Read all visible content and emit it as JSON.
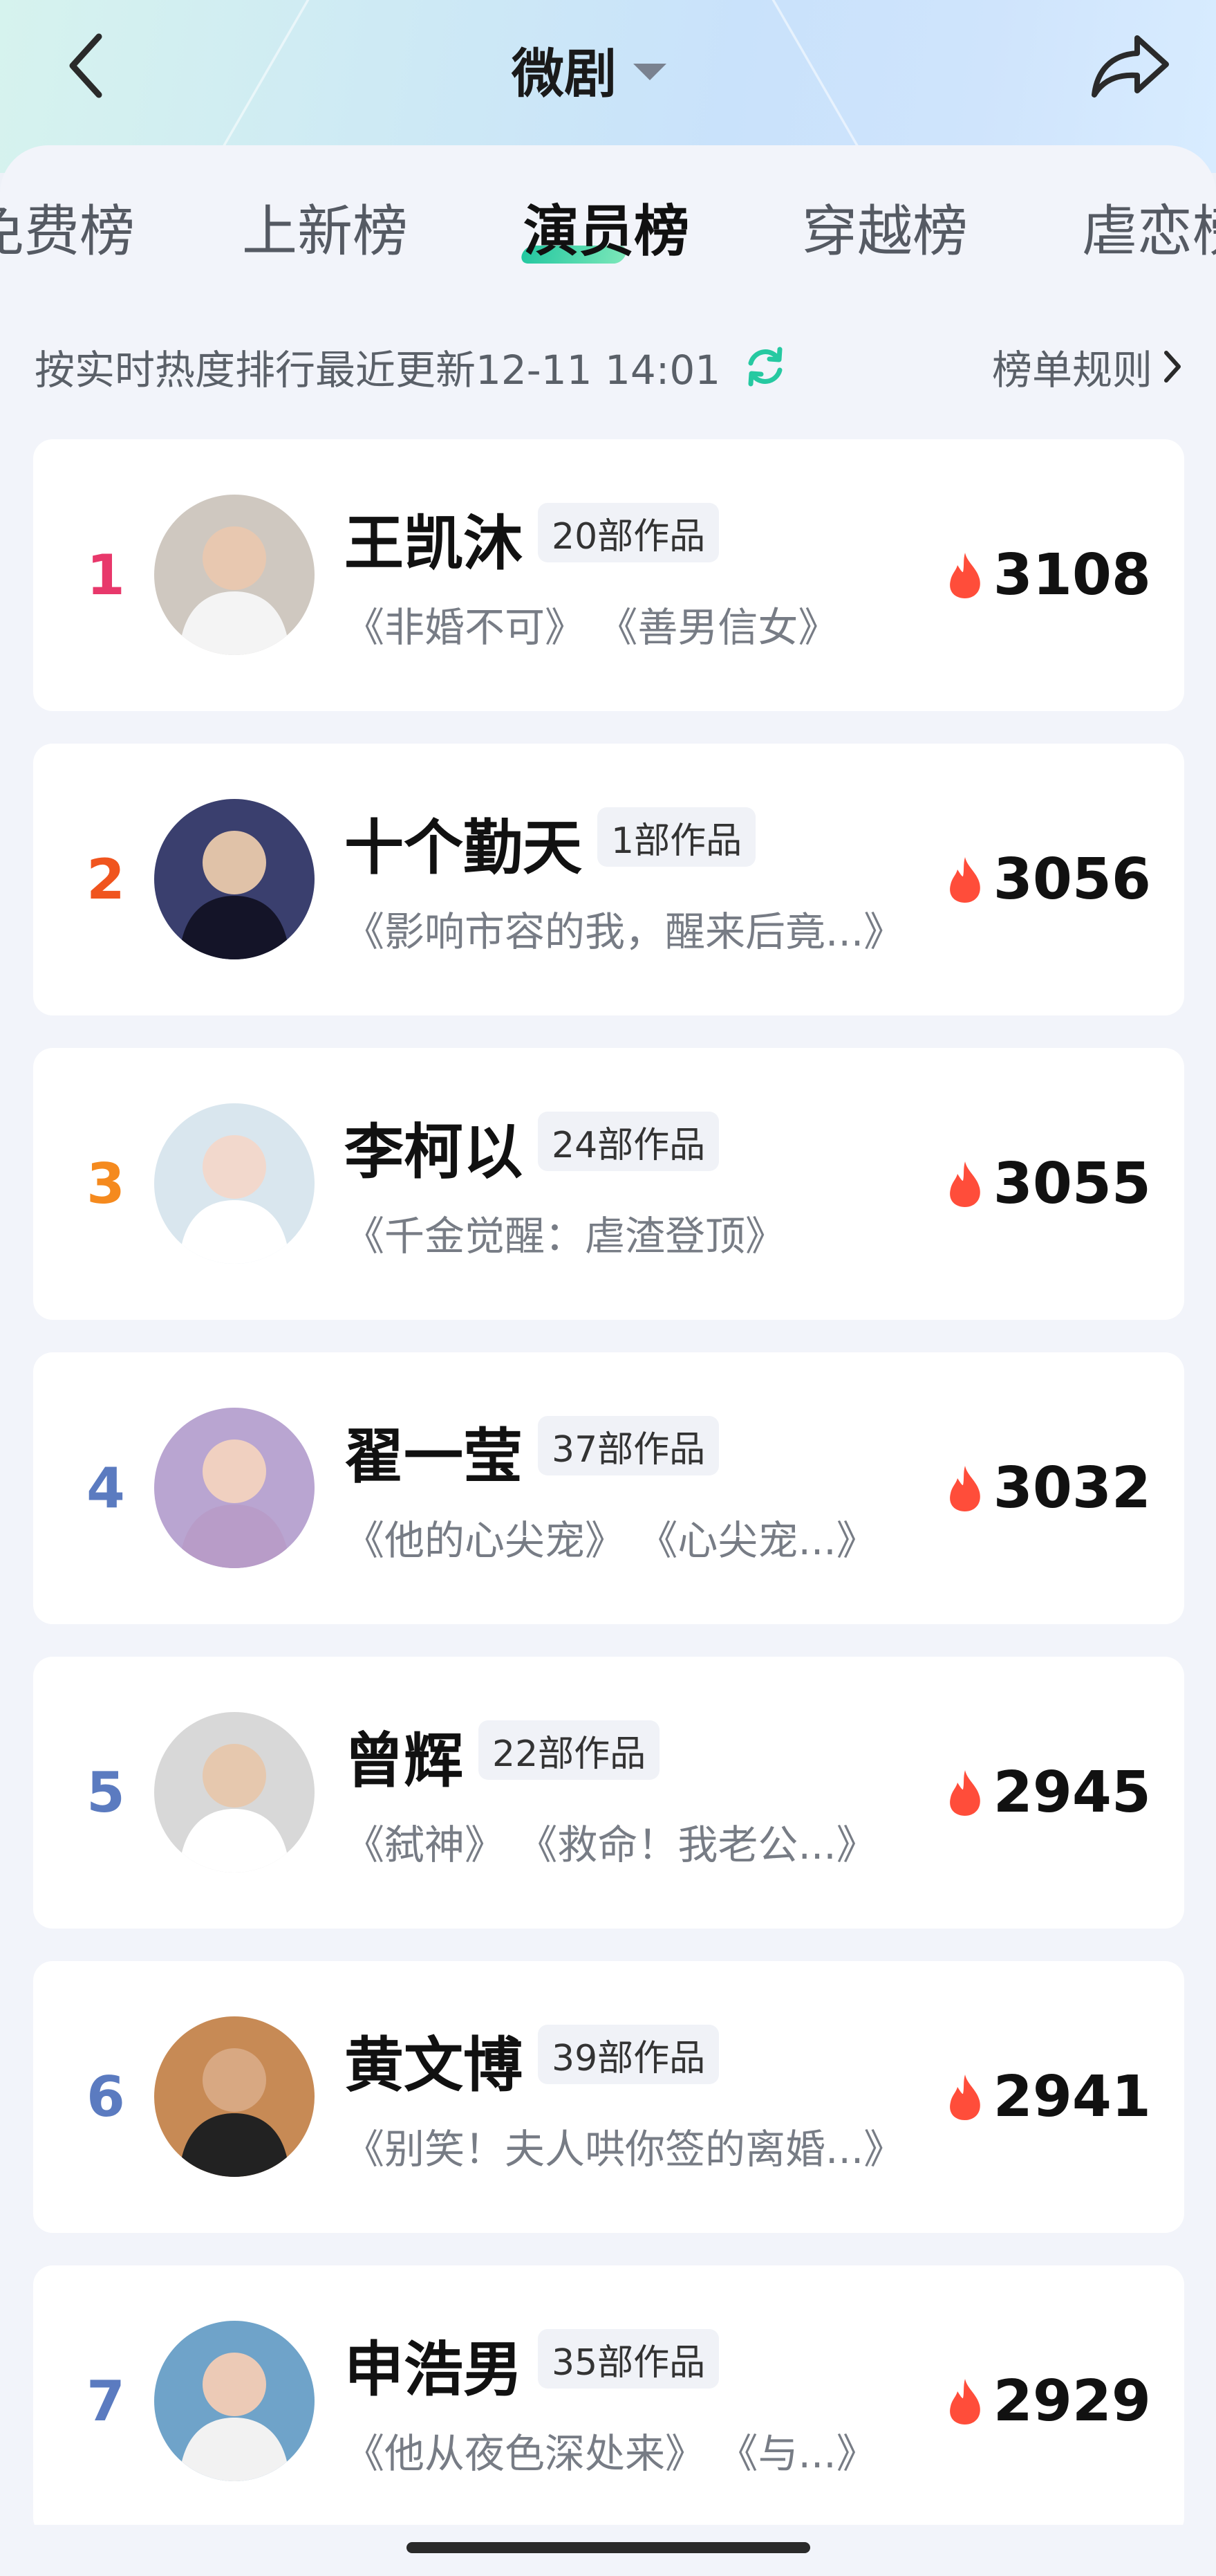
{
  "header": {
    "title": "微剧",
    "back_icon": "chevron-left-icon",
    "share_icon": "share-arrow-icon",
    "dropdown_icon": "caret-down-icon"
  },
  "tabs": [
    {
      "label": "免费榜",
      "active": false
    },
    {
      "label": "上新榜",
      "active": false
    },
    {
      "label": "演员榜",
      "active": true
    },
    {
      "label": "穿越榜",
      "active": false
    },
    {
      "label": "虐恋榜",
      "active": false
    }
  ],
  "info": {
    "update_text": "按实时热度排行最近更新12-11 14:01",
    "rules_label": "榜单规则",
    "refresh_icon": "refresh-icon",
    "chevron_icon": "chevron-right-icon"
  },
  "colors": {
    "rank_1": "#e8386b",
    "rank_2": "#f0541e",
    "rank_3": "#f58a1e",
    "rank_other": "#5b7bc0",
    "accent": "#26c9a1",
    "flame": "#ff4d3a"
  },
  "actors": [
    {
      "rank": "1",
      "name": "王凯沐",
      "works": "20部作品",
      "dramas": "《非婚不可》 《善男信女》",
      "heat": "3108"
    },
    {
      "rank": "2",
      "name": "十个勤天",
      "works": "1部作品",
      "dramas": "《影响市容的我，醒来后竟...》",
      "heat": "3056"
    },
    {
      "rank": "3",
      "name": "李柯以",
      "works": "24部作品",
      "dramas": "《千金觉醒：虐渣登顶》",
      "heat": "3055"
    },
    {
      "rank": "4",
      "name": "翟一莹",
      "works": "37部作品",
      "dramas": "《他的心尖宠》 《心尖宠...》",
      "heat": "3032"
    },
    {
      "rank": "5",
      "name": "曾辉",
      "works": "22部作品",
      "dramas": "《弑神》 《救命！我老公...》",
      "heat": "2945"
    },
    {
      "rank": "6",
      "name": "黄文博",
      "works": "39部作品",
      "dramas": "《别笑！夫人哄你签的离婚...》",
      "heat": "2941"
    },
    {
      "rank": "7",
      "name": "申浩男",
      "works": "35部作品",
      "dramas": "《他从夜色深处来》 《与...》",
      "heat": "2929"
    }
  ]
}
